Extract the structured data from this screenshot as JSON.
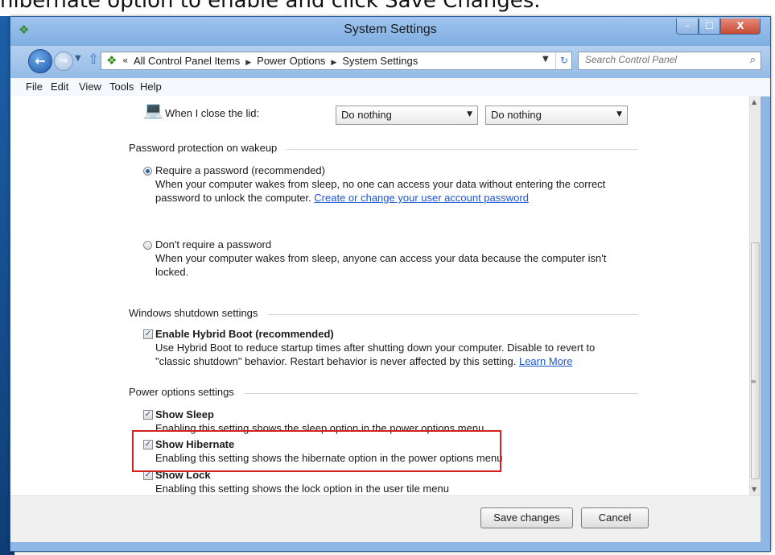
{
  "caption": "hibernate option to enable and click Save Changes.",
  "window": {
    "title": "System Settings",
    "minimize": "–",
    "maximize": "☐",
    "close": "X"
  },
  "nav": {
    "crumbs": [
      "All Control Panel Items",
      "Power Options",
      "System Settings"
    ],
    "search_placeholder": "Search Control Panel"
  },
  "menu": [
    "File",
    "Edit",
    "View",
    "Tools",
    "Help"
  ],
  "lid": {
    "label": "When I close the lid:",
    "battery_value": "Do nothing",
    "plugged_value": "Do nothing"
  },
  "password": {
    "section": "Password protection on wakeup",
    "require_label": "Require a password (recommended)",
    "require_desc1": "When your computer wakes from sleep, no one can access your data without entering the correct",
    "require_desc2": "password to unlock the computer.",
    "require_link": "Create or change your user account password",
    "norequire_label": "Don't require a password",
    "norequire_desc1": "When your computer wakes from sleep, anyone can access your data because the computer isn't",
    "norequire_desc2": "locked.",
    "selected": "require"
  },
  "shutdown": {
    "section": "Windows shutdown settings",
    "hybrid_label": "Enable Hybrid Boot (recommended)",
    "hybrid_desc1": "Use Hybrid Boot to reduce startup times after shutting down your computer. Disable to revert to",
    "hybrid_desc2": "\"classic shutdown\" behavior. Restart behavior is never affected by this setting.",
    "hybrid_link": "Learn More",
    "hybrid_checked": true
  },
  "power": {
    "section": "Power options settings",
    "sleep_label": "Show Sleep",
    "sleep_desc": "Enabling this setting shows the sleep option in the power options menu",
    "hibernate_label": "Show Hibernate",
    "hibernate_desc": "Enabling this setting shows the hibernate option in the power options menu",
    "lock_label": "Show Lock",
    "lock_desc": "Enabling this setting shows the lock option in the user tile menu",
    "checkmark": "✓"
  },
  "buttons": {
    "save": "Save changes",
    "cancel": "Cancel"
  },
  "colors": {
    "highlight": "#d42020",
    "link": "#1a56d6",
    "title_bar": "#8fb7e6"
  }
}
